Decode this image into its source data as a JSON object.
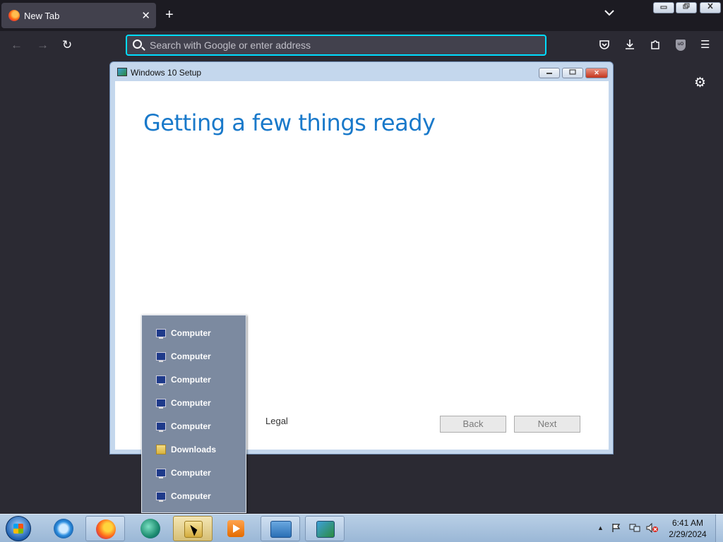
{
  "browser": {
    "tab_title": "New Tab",
    "tab_close": "✕",
    "new_tab": "+",
    "tab_list": "⌄",
    "url_placeholder": "Search with Google or enter address",
    "back": "←",
    "forward": "→",
    "reload": "↻",
    "menu": "☰",
    "settings": "⚙",
    "window_min": "▭",
    "window_restore": "❐",
    "window_close": "✕"
  },
  "setup_window": {
    "title": "Windows 10 Setup",
    "heading": "Getting a few things ready",
    "legal": "Legal",
    "back_button": "Back",
    "next_button": "Next",
    "min": "–",
    "restore": "▭",
    "close": "✕"
  },
  "jump_list": {
    "items": [
      {
        "label": "Computer",
        "icon": "computer-icon"
      },
      {
        "label": "Computer",
        "icon": "computer-icon"
      },
      {
        "label": "Computer",
        "icon": "computer-icon"
      },
      {
        "label": "Computer",
        "icon": "computer-icon"
      },
      {
        "label": "Computer",
        "icon": "computer-icon"
      },
      {
        "label": "Downloads",
        "icon": "folder-icon"
      },
      {
        "label": "Computer",
        "icon": "computer-icon"
      },
      {
        "label": "Computer",
        "icon": "computer-icon"
      }
    ]
  },
  "taskbar": {
    "clock_time": "6:41 AM",
    "clock_date": "2/29/2024",
    "tray_arrow": "▲"
  }
}
